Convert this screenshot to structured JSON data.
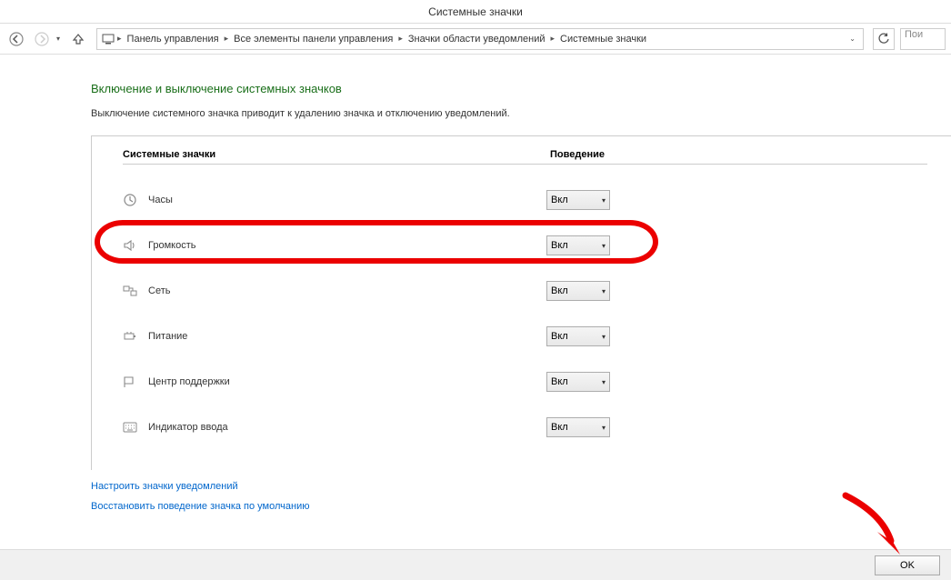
{
  "window": {
    "title": "Системные значки"
  },
  "nav": {
    "breadcrumbs": [
      "Панель управления",
      "Все элементы панели управления",
      "Значки области уведомлений",
      "Системные значки"
    ],
    "search_placeholder": "Пои"
  },
  "page": {
    "heading": "Включение и выключение системных значков",
    "subtext": "Выключение системного значка приводит к удалению значка и отключению уведомлений.",
    "col_icon": "Системные значки",
    "col_behavior": "Поведение",
    "option_on": "Вкл",
    "rows": [
      {
        "icon": "clock-icon",
        "label": "Часы",
        "value": "Вкл"
      },
      {
        "icon": "volume-icon",
        "label": "Громкость",
        "value": "Вкл"
      },
      {
        "icon": "network-icon",
        "label": "Сеть",
        "value": "Вкл"
      },
      {
        "icon": "power-icon",
        "label": "Питание",
        "value": "Вкл"
      },
      {
        "icon": "action-center-icon",
        "label": "Центр поддержки",
        "value": "Вкл"
      },
      {
        "icon": "input-indicator-icon",
        "label": "Индикатор ввода",
        "value": "Вкл"
      }
    ],
    "link_customize": "Настроить значки уведомлений",
    "link_restore": "Восстановить поведение значка по умолчанию"
  },
  "footer": {
    "ok": "OK"
  }
}
